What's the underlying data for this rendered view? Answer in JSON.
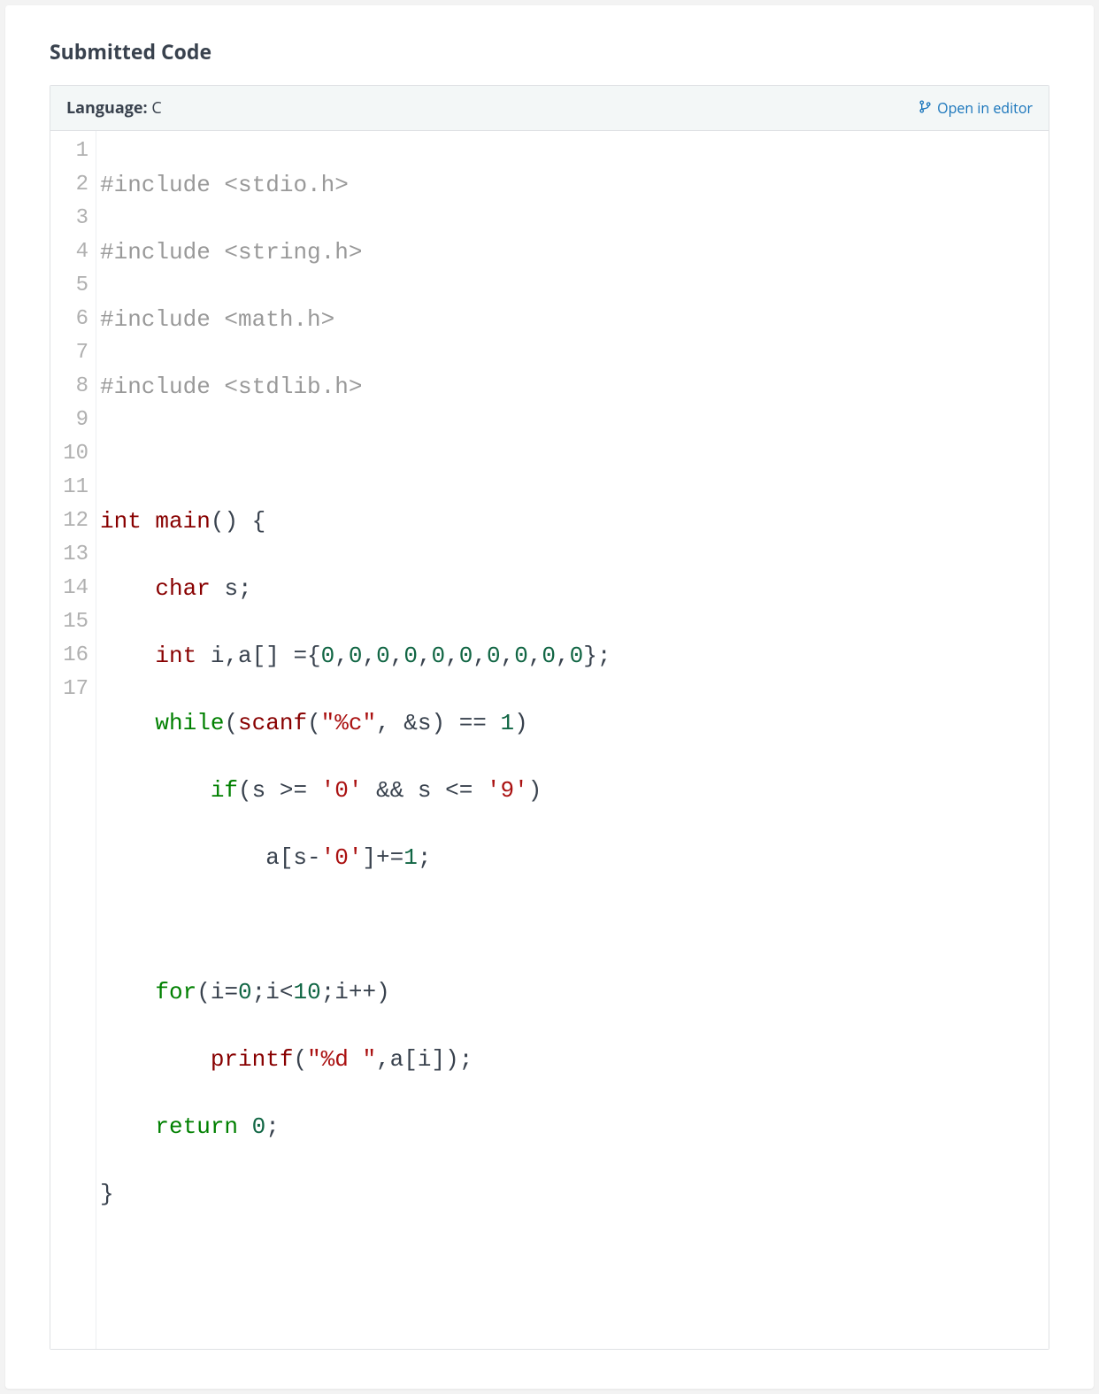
{
  "section_title": "Submitted Code",
  "header": {
    "language_label": "Language:",
    "language_value": " C",
    "open_in_editor": "Open in editor"
  },
  "line_numbers": [
    "1",
    "2",
    "3",
    "4",
    "5",
    "6",
    "7",
    "8",
    "9",
    "10",
    "11",
    "12",
    "13",
    "14",
    "15",
    "16",
    "17"
  ],
  "code": {
    "l1_a": "#include",
    "l1_b": " <stdio.h>",
    "l2_a": "#include",
    "l2_b": " <string.h>",
    "l3_a": "#include",
    "l3_b": " <math.h>",
    "l4_a": "#include",
    "l4_b": " <stdlib.h>",
    "l5": "",
    "l6_a": "int",
    "l6_b": " ",
    "l6_c": "main",
    "l6_d": "() {",
    "l7_a": "    ",
    "l7_b": "char",
    "l7_c": " s;",
    "l8_a": "    ",
    "l8_b": "int",
    "l8_c": " i,a[] ={",
    "l8_d": "0",
    "l8_e": ",",
    "l8_f": "0",
    "l8_g": ",",
    "l8_h": "0",
    "l8_i": ",",
    "l8_j": "0",
    "l8_k": ",",
    "l8_l": "0",
    "l8_m": ",",
    "l8_n": "0",
    "l8_o": ",",
    "l8_p": "0",
    "l8_q": ",",
    "l8_r": "0",
    "l8_s": ",",
    "l8_t": "0",
    "l8_u": ",",
    "l8_v": "0",
    "l8_w": "};",
    "l9_a": "    ",
    "l9_b": "while",
    "l9_c": "(",
    "l9_d": "scanf",
    "l9_e": "(",
    "l9_f": "\"%c\"",
    "l9_g": ", &s) == ",
    "l9_h": "1",
    "l9_i": ")",
    "l10_a": "        ",
    "l10_b": "if",
    "l10_c": "(s >= ",
    "l10_d": "'0'",
    "l10_e": " && s <= ",
    "l10_f": "'9'",
    "l10_g": ")",
    "l11_a": "            a[s-",
    "l11_b": "'0'",
    "l11_c": "]+=",
    "l11_d": "1",
    "l11_e": ";",
    "l12": "",
    "l13_a": "    ",
    "l13_b": "for",
    "l13_c": "(i=",
    "l13_d": "0",
    "l13_e": ";i<",
    "l13_f": "10",
    "l13_g": ";i++)",
    "l14_a": "        ",
    "l14_b": "printf",
    "l14_c": "(",
    "l14_d": "\"%d \"",
    "l14_e": ",a[i]);",
    "l15_a": "    ",
    "l15_b": "return",
    "l15_c": " ",
    "l15_d": "0",
    "l15_e": ";",
    "l16": "}",
    "l17": ""
  }
}
